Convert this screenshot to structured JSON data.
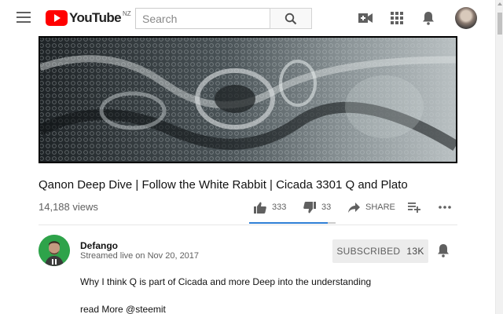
{
  "header": {
    "logo_text": "YouTube",
    "country_code": "NZ",
    "search_placeholder": "Search",
    "search_value": ""
  },
  "video": {
    "title": "Qanon Deep Dive | Follow the White Rabbit | Cicada 3301 Q and Plato",
    "views": "14,188 views",
    "likes": "333",
    "dislikes": "33",
    "share_label": "SHARE",
    "like_ratio": 0.91
  },
  "channel": {
    "name": "Defango",
    "date": "Streamed live on Nov 20, 2017",
    "subscribe_label": "SUBSCRIBED",
    "subscriber_count": "13K"
  },
  "description": {
    "line1": "Why I think Q is part of Cicada and more Deep into the understanding",
    "line2": "read More @steemit"
  },
  "colors": {
    "brand_red": "#ff0000",
    "ratio_blue": "#2f7fd6",
    "channel_avatar_green": "#2ea34a"
  },
  "icons": [
    "menu-icon",
    "search-icon",
    "video-camera-icon",
    "apps-grid-icon",
    "notifications-bell-icon",
    "thumbs-up-icon",
    "thumbs-down-icon",
    "share-arrow-icon",
    "add-to-playlist-icon",
    "more-dots-icon"
  ]
}
